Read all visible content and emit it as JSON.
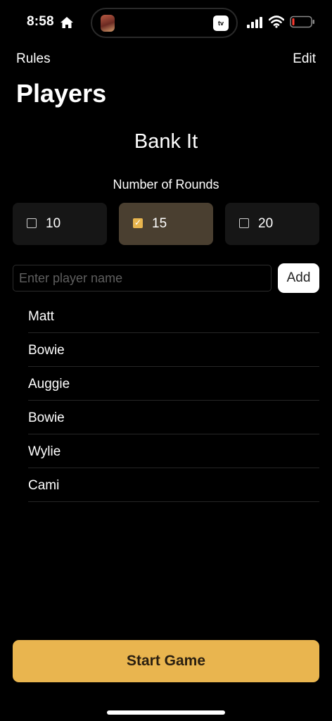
{
  "status_bar": {
    "time": "8:58",
    "island_badge": "tv",
    "icons": [
      "home-icon",
      "cellular-signal-icon",
      "wifi-icon",
      "battery-low-icon"
    ]
  },
  "nav": {
    "left_label": "Rules",
    "right_label": "Edit"
  },
  "page": {
    "title": "Players",
    "game_name": "Bank It",
    "rounds_label": "Number of Rounds"
  },
  "rounds": {
    "options": [
      {
        "label": "10",
        "checked": false
      },
      {
        "label": "15",
        "checked": true
      },
      {
        "label": "20",
        "checked": false
      }
    ],
    "check_glyph": "✓"
  },
  "player_entry": {
    "placeholder": "Enter player name",
    "value": "",
    "add_label": "Add"
  },
  "players": [
    "Matt",
    "Bowie",
    "Auggie",
    "Bowie",
    "Wylie",
    "Cami"
  ],
  "actions": {
    "start_label": "Start Game"
  },
  "colors": {
    "accent": "#e9b54f",
    "selected_option_bg": "#4a3f30",
    "option_bg": "#161616",
    "background": "#000000"
  }
}
